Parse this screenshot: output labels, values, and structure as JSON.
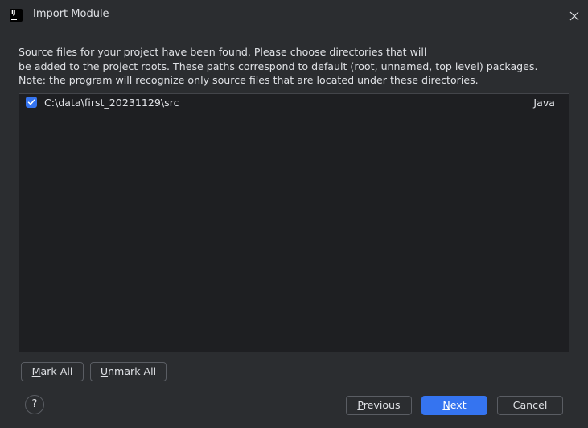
{
  "window": {
    "title": "Import Module",
    "icon": "intellij-icon",
    "close_icon": "close-icon"
  },
  "description": {
    "lines": [
      "Source files for your project have been found. Please choose directories that will",
      "be added to the project roots. These paths correspond to default (root, unnamed, top level) packages.",
      "Note: the program will recognize only source files that are located under these directories."
    ]
  },
  "list": {
    "rows": [
      {
        "checked": true,
        "path": "C:\\data\\first_20231129\\src",
        "type": "Java"
      }
    ]
  },
  "buttons": {
    "mark_all": {
      "mnemonic": "M",
      "rest": "ark All"
    },
    "unmark_all": {
      "mnemonic": "U",
      "rest": "nmark All"
    },
    "help": "?",
    "previous": {
      "mnemonic": "P",
      "rest": "revious"
    },
    "next": {
      "mnemonic": "N",
      "rest": "ext"
    },
    "cancel": "Cancel"
  },
  "colors": {
    "background": "#2b2d30",
    "list_background": "#1e1f22",
    "accent": "#3574f0",
    "text": "#dfe1e5",
    "border": "#5a5d63"
  }
}
